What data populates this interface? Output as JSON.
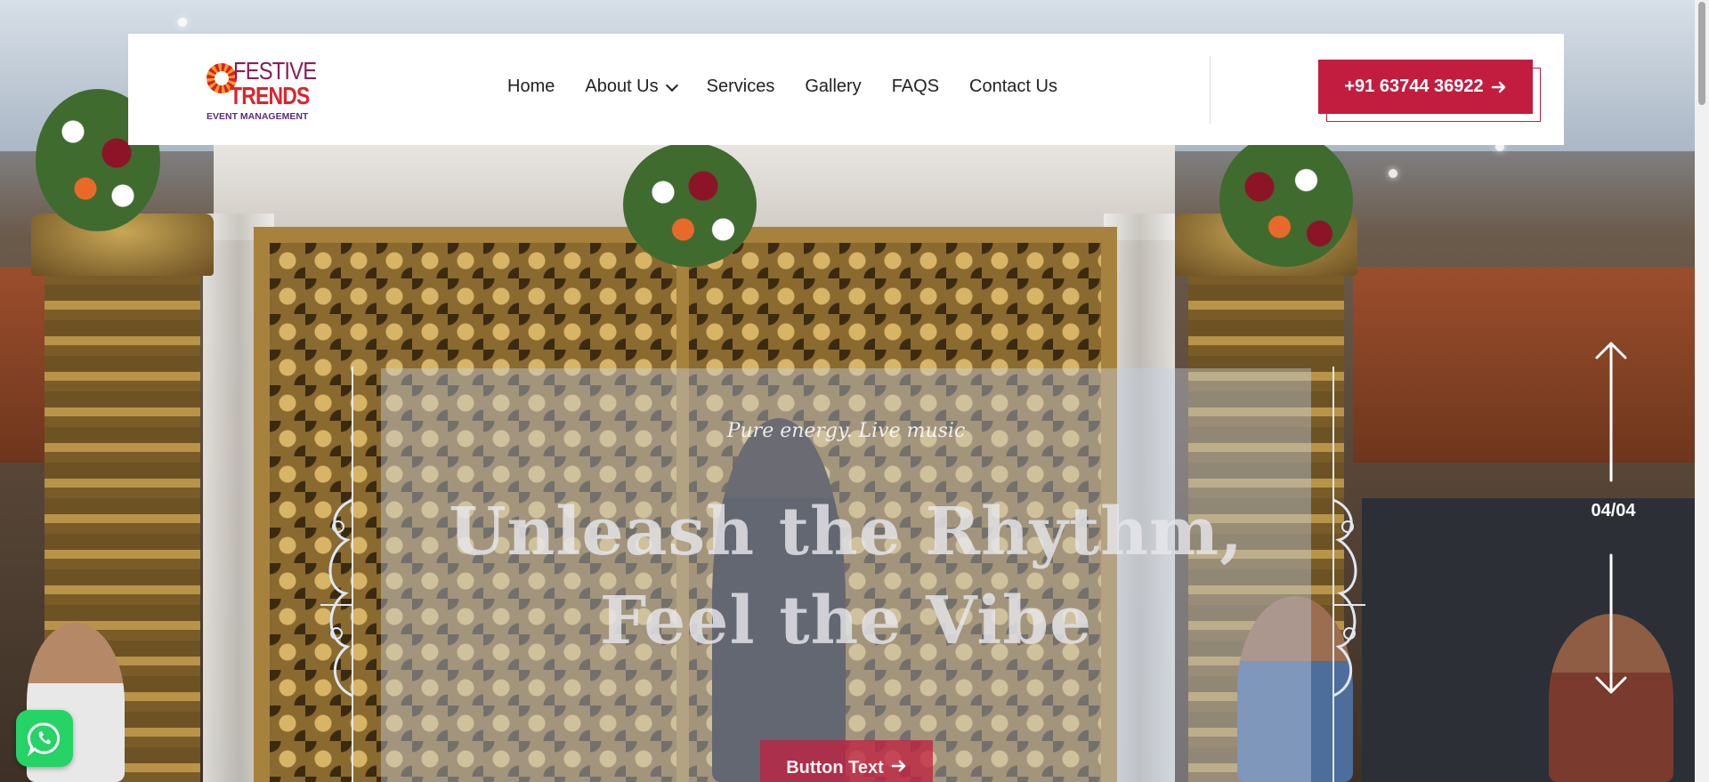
{
  "brand": {
    "line1": "FESTIVE",
    "line2": "TRENDS",
    "line3": "EVENT MANAGEMENT"
  },
  "nav": {
    "items": [
      {
        "label": "Home"
      },
      {
        "label": "About Us"
      },
      {
        "label": "Services"
      },
      {
        "label": "Gallery"
      },
      {
        "label": "FAQS"
      },
      {
        "label": "Contact Us"
      }
    ]
  },
  "call_button": {
    "label": "+91 63744 36922",
    "icon": "arrow-right-icon"
  },
  "hero": {
    "tagline": "Pure energy. Live music",
    "headline_line1": "Unleash the Rhythm,",
    "headline_line2": "Feel the Vibe",
    "cta_label": "Button Text",
    "cta_icon": "arrow-right-icon"
  },
  "slider": {
    "counter": "04/04",
    "prev_icon": "arrow-up-icon",
    "next_icon": "arrow-down-icon"
  },
  "whatsapp": {
    "icon": "whatsapp-icon"
  },
  "colors": {
    "accent": "#c21d3f",
    "logo_purple": "#8b1d5a",
    "logo_red": "#d8262f",
    "whatsapp_green": "#25d366"
  }
}
